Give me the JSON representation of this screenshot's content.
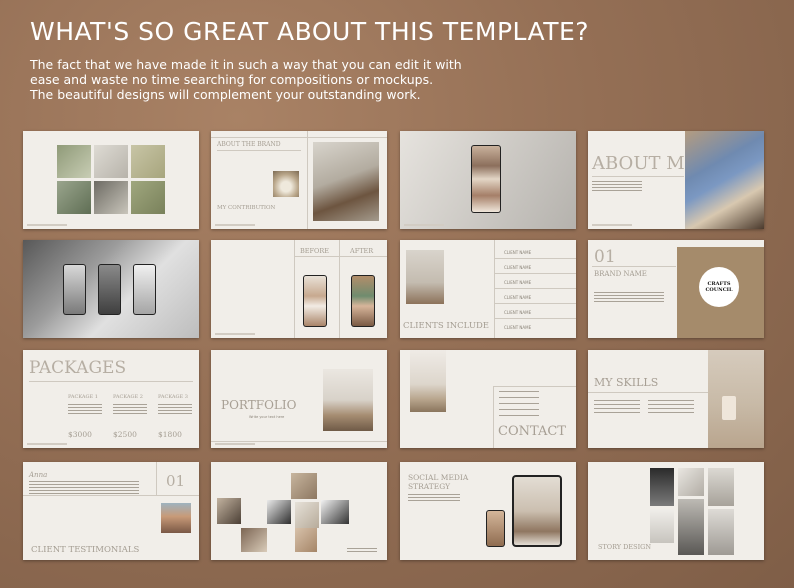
{
  "header": {
    "title": "WHAT'S SO GREAT ABOUT THIS TEMPLATE?",
    "description_lines": [
      "The fact that we have made it in such a way that you can edit it with",
      "ease and waste no time searching for compositions or mockups.",
      "The beautiful designs will complement your outstanding work."
    ]
  },
  "slides": {
    "about_brand": {
      "heading": "ABOUT THE BRAND",
      "subheading": "MY CONTRIBUTION"
    },
    "about_me": {
      "title": "ABOUT ME"
    },
    "phones": {
      "before": "BEFORE",
      "after": "AFTER"
    },
    "clients": {
      "title": "CLIENTS INCLUDE",
      "names": [
        "CLIENT NAME",
        "CLIENT NAME",
        "CLIENT NAME",
        "CLIENT NAME",
        "CLIENT NAME",
        "CLIENT NAME"
      ]
    },
    "brand": {
      "number": "01",
      "name": "BRAND NAME",
      "logo_text": "CRAFTS COUNCIL"
    },
    "packages": {
      "title": "PACKAGES",
      "items": [
        {
          "name": "PACKAGE 1",
          "price": "$3000"
        },
        {
          "name": "PACKAGE 2",
          "price": "$2500"
        },
        {
          "name": "PACKAGE 3",
          "price": "$1800"
        }
      ]
    },
    "portfolio": {
      "title": "PORTFOLIO",
      "subtitle": "Write your text here"
    },
    "contact": {
      "title": "CONTACT"
    },
    "skills": {
      "title": "MY SKILLS"
    },
    "testimonials": {
      "name": "Anna",
      "number": "01",
      "title": "CLIENT TESTIMONIALS"
    },
    "social": {
      "title_line1": "SOCIAL MEDIA",
      "title_line2": "STRATEGY"
    },
    "story": {
      "title": "STORY DESIGN"
    }
  },
  "colors": {
    "background": "#946f55",
    "slide": "#f1eee9",
    "accent_serif": "#a49d92",
    "tan_block": "#a58b6b"
  }
}
